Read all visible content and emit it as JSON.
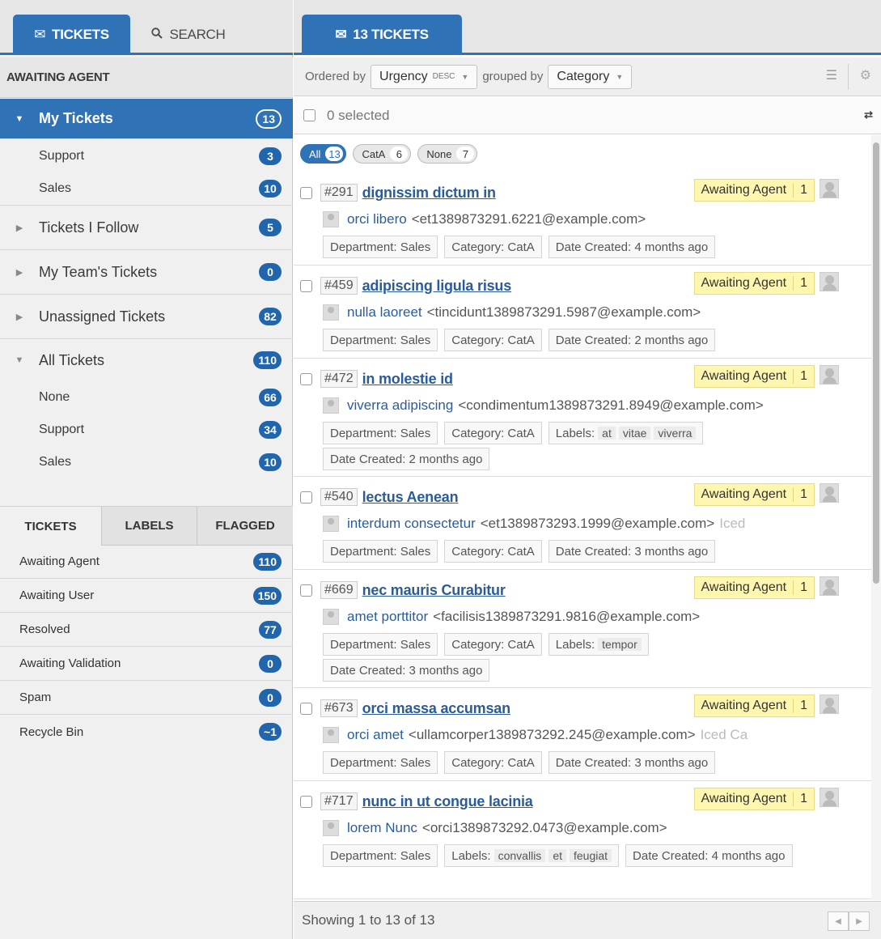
{
  "left_tabs": {
    "tickets": {
      "icon": "envelope-icon",
      "label": "TICKETS"
    },
    "search": {
      "icon": "search-icon",
      "label": "SEARCH"
    }
  },
  "section_header": "AWAITING AGENT",
  "nav": {
    "my_tickets": {
      "label": "My Tickets",
      "count": "13"
    },
    "my_support": {
      "label": "Support",
      "count": "3"
    },
    "my_sales": {
      "label": "Sales",
      "count": "10"
    },
    "follow": {
      "label": "Tickets I Follow",
      "count": "5"
    },
    "team": {
      "label": "My Team's Tickets",
      "count": "0"
    },
    "unassigned": {
      "label": "Unassigned Tickets",
      "count": "82"
    },
    "all": {
      "label": "All Tickets",
      "count": "110"
    },
    "all_none": {
      "label": "None",
      "count": "66"
    },
    "all_support": {
      "label": "Support",
      "count": "34"
    },
    "all_sales": {
      "label": "Sales",
      "count": "10"
    }
  },
  "status_tabs": {
    "tickets": "TICKETS",
    "labels": "LABELS",
    "flagged": "FLAGGED"
  },
  "statuses": [
    {
      "label": "Awaiting Agent",
      "count": "110"
    },
    {
      "label": "Awaiting User",
      "count": "150"
    },
    {
      "label": "Resolved",
      "count": "77"
    },
    {
      "label": "Awaiting Validation",
      "count": "0"
    },
    {
      "label": "Spam",
      "count": "0"
    },
    {
      "label": "Recycle Bin",
      "count": "~1"
    }
  ],
  "right_tab": {
    "icon": "envelope-icon",
    "label": "13 TICKETS"
  },
  "order": {
    "ordered_by": "Ordered by",
    "order_value": "Urgency",
    "order_dir": "DESC",
    "grouped_by": "grouped by",
    "group_value": "Category"
  },
  "selection": "0 selected",
  "filters": {
    "all": {
      "label": "All",
      "count": "13"
    },
    "cata": {
      "label": "CatA",
      "count": "6"
    },
    "none": {
      "label": "None",
      "count": "7"
    }
  },
  "tickets": [
    {
      "id": "#291",
      "title": "dignissim dictum in",
      "status": "Awaiting Agent",
      "status_count": "1",
      "name": "orci libero",
      "email": "<et1389873291.6221@example.com>",
      "extra": "",
      "department": "Department: Sales",
      "category": "Category: CatA",
      "labels_prefix": "",
      "labels": [],
      "date": "Date Created: 4 months ago"
    },
    {
      "id": "#459",
      "title": "adipiscing ligula risus",
      "status": "Awaiting Agent",
      "status_count": "1",
      "name": "nulla laoreet",
      "email": "<tincidunt1389873291.5987@example.com>",
      "extra": "",
      "department": "Department: Sales",
      "category": "Category: CatA",
      "labels_prefix": "",
      "labels": [],
      "date": "Date Created: 2 months ago"
    },
    {
      "id": "#472",
      "title": "in molestie id",
      "status": "Awaiting Agent",
      "status_count": "1",
      "name": "viverra adipiscing",
      "email": "<condimentum1389873291.8949@example.com>",
      "extra": "",
      "department": "Department: Sales",
      "category": "Category: CatA",
      "labels_prefix": "Labels:",
      "labels": [
        "at",
        "vitae",
        "viverra"
      ],
      "date": "Date Created: 2 months ago"
    },
    {
      "id": "#540",
      "title": "lectus Aenean",
      "status": "Awaiting Agent",
      "status_count": "1",
      "name": "interdum consectetur",
      "email": "<et1389873293.1999@example.com>",
      "extra": "Iced",
      "department": "Department: Sales",
      "category": "Category: CatA",
      "labels_prefix": "",
      "labels": [],
      "date": "Date Created: 3 months ago"
    },
    {
      "id": "#669",
      "title": "nec mauris Curabitur",
      "status": "Awaiting Agent",
      "status_count": "1",
      "name": "amet porttitor",
      "email": "<facilisis1389873291.9816@example.com>",
      "extra": "",
      "department": "Department: Sales",
      "category": "Category: CatA",
      "labels_prefix": "Labels:",
      "labels": [
        "tempor"
      ],
      "date": "Date Created: 3 months ago"
    },
    {
      "id": "#673",
      "title": "orci massa accumsan",
      "status": "Awaiting Agent",
      "status_count": "1",
      "name": "orci amet",
      "email": "<ullamcorper1389873292.245@example.com>",
      "extra": "Iced Ca",
      "department": "Department: Sales",
      "category": "Category: CatA",
      "labels_prefix": "",
      "labels": [],
      "date": "Date Created: 3 months ago"
    },
    {
      "id": "#717",
      "title": "nunc in ut congue lacinia",
      "status": "Awaiting Agent",
      "status_count": "1",
      "name": "lorem Nunc",
      "email": "<orci1389873292.0473@example.com>",
      "extra": "",
      "department": "Department: Sales",
      "category": "",
      "labels_prefix": "Labels:",
      "labels": [
        "convallis",
        "et",
        "feugiat"
      ],
      "date": "Date Created: 4 months ago"
    }
  ],
  "footer": "Showing 1 to 13 of 13",
  "colors": {
    "accent": "#2f72b5",
    "badge": "#2166ad",
    "status_bg": "#fff7b0",
    "link": "#2b5c9a"
  }
}
